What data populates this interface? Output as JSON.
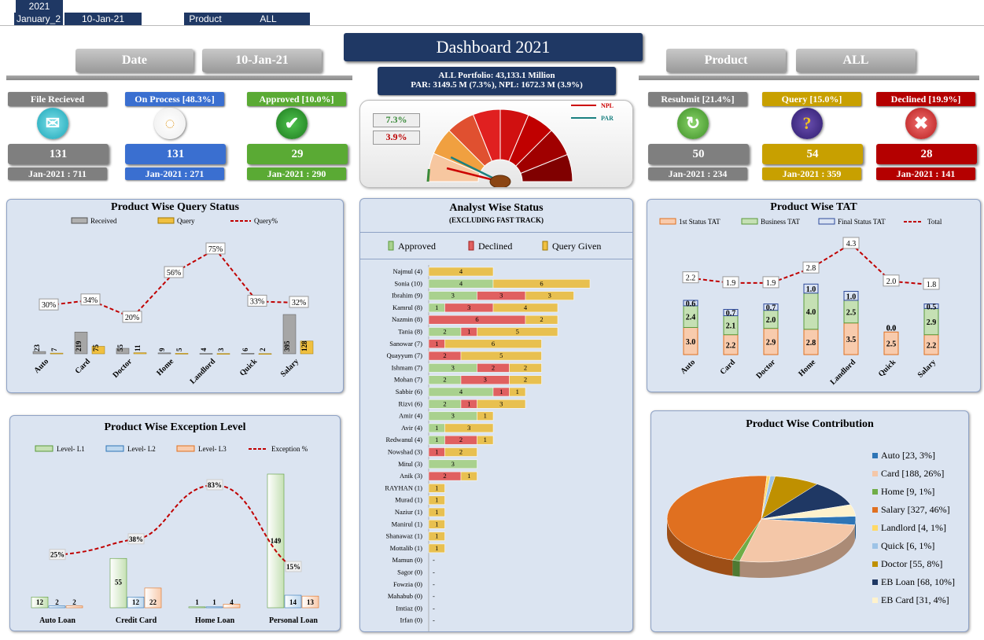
{
  "filters": {
    "year": "2021",
    "month": "January_2",
    "date": "10-Jan-21",
    "product_label": "Product",
    "product_value": "ALL"
  },
  "header": {
    "date_label": "Date",
    "date_value": "10-Jan-21",
    "title": "Dashboard 2021",
    "product_label": "Product",
    "product_value": "ALL",
    "portfolio_line1": "ALL Portfolio: 43,133.1  Million",
    "portfolio_line2": "PAR: 3149.5 M (7.3%), NPL: 1672.3 M (3.9%)"
  },
  "gauge": {
    "par": "7.3%",
    "npl": "3.9%",
    "legend_npl": "NPL",
    "legend_par": "PAR",
    "par_value": 7.3,
    "npl_value": 3.9
  },
  "kpis": [
    {
      "label": "File Recieved",
      "count": "131",
      "month": "Jan-2021 : 711",
      "color": "#7f7f7f",
      "icon": "envelope-icon"
    },
    {
      "label": "On Process [48.3%]",
      "count": "131",
      "month": "Jan-2021 : 271",
      "color": "#3a6fd0",
      "icon": "loading-icon"
    },
    {
      "label": "Approved [10.0%]",
      "count": "29",
      "month": "Jan-2021 : 290",
      "color": "#5aaa34",
      "icon": "check-icon"
    },
    {
      "label": "Resubmit [21.4%]",
      "count": "50",
      "month": "Jan-2021 : 234",
      "color": "#7f7f7f",
      "icon": "refresh-icon"
    },
    {
      "label": "Query [15.0%]",
      "count": "54",
      "month": "Jan-2021 : 359",
      "color": "#c8a000",
      "icon": "question-icon"
    },
    {
      "label": "Declined [19.9%]",
      "count": "28",
      "month": "Jan-2021 : 141",
      "color": "#b40000",
      "icon": "cross-icon"
    }
  ],
  "chart_data": [
    {
      "type": "bar",
      "title": "Product Wise Query Status",
      "categories": [
        "Auto",
        "Card",
        "Doctor",
        "Home",
        "Landlord",
        "Quick",
        "Salary"
      ],
      "series": [
        {
          "name": "Received",
          "values": [
            23,
            219,
            55,
            9,
            4,
            6,
            395
          ]
        },
        {
          "name": "Query",
          "values": [
            7,
            75,
            11,
            5,
            3,
            2,
            128
          ]
        },
        {
          "name": "Query%",
          "values": [
            30,
            34,
            20,
            56,
            75,
            33,
            32
          ],
          "labels": [
            "30%",
            "34%",
            "20%",
            "56%",
            "75%",
            "33%",
            "32%"
          ]
        }
      ]
    },
    {
      "type": "bar",
      "title": "Analyst Wise Status",
      "subtitle": "(EXCLUDING FAST TRACK)",
      "legend": [
        "Approved",
        "Declined",
        "Query Given"
      ],
      "analysts": [
        {
          "name": "Najmul (4)",
          "approved": "",
          "declined": "-",
          "query": "4",
          "a": 0,
          "d": 0,
          "q": 4
        },
        {
          "name": "Sonia (10)",
          "approved": "4",
          "declined": "-",
          "query": "6",
          "a": 4,
          "d": 0,
          "q": 6
        },
        {
          "name": "Ibrahim (9)",
          "approved": "3",
          "declined": "3",
          "query": "3",
          "a": 3,
          "d": 3,
          "q": 3
        },
        {
          "name": "Kamrul (8)",
          "approved": "1",
          "declined": "3",
          "query": "4",
          "a": 1,
          "d": 3,
          "q": 4
        },
        {
          "name": "Nazmin (8)",
          "approved": "",
          "declined": "6",
          "query": "2",
          "a": 0,
          "d": 6,
          "q": 2
        },
        {
          "name": "Tania (8)",
          "approved": "2",
          "declined": "1",
          "query": "5",
          "a": 2,
          "d": 1,
          "q": 5
        },
        {
          "name": "Sanowar (7)",
          "approved": "",
          "declined": "1",
          "query": "6",
          "a": 0,
          "d": 1,
          "q": 6
        },
        {
          "name": "Quayyum (7)",
          "approved": "",
          "declined": "2",
          "query": "5",
          "a": 0,
          "d": 2,
          "q": 5
        },
        {
          "name": "Ishmam (7)",
          "approved": "3",
          "declined": "2",
          "query": "2",
          "a": 3,
          "d": 2,
          "q": 2
        },
        {
          "name": "Mohan (7)",
          "approved": "2",
          "declined": "3",
          "query": "2",
          "a": 2,
          "d": 3,
          "q": 2
        },
        {
          "name": "Sabbir (6)",
          "approved": "4",
          "declined": "1",
          "query": "1",
          "a": 4,
          "d": 1,
          "q": 1
        },
        {
          "name": "Rizvi (6)",
          "approved": "2",
          "declined": "1",
          "query": "3",
          "a": 2,
          "d": 1,
          "q": 3
        },
        {
          "name": "Amir (4)",
          "approved": "3",
          "declined": "",
          "query": "1",
          "a": 3,
          "d": 0,
          "q": 1
        },
        {
          "name": "Avir (4)",
          "approved": "1",
          "declined": "",
          "query": "3",
          "a": 1,
          "d": 0,
          "q": 3
        },
        {
          "name": "Redwanul (4)",
          "approved": "1",
          "declined": "2",
          "query": "1",
          "a": 1,
          "d": 2,
          "q": 1
        },
        {
          "name": "Nowshad (3)",
          "approved": "",
          "declined": "1",
          "query": "2",
          "a": 0,
          "d": 1,
          "q": 2
        },
        {
          "name": "Mitul (3)",
          "approved": "3",
          "declined": "",
          "query": "",
          "a": 3,
          "d": 0,
          "q": 0
        },
        {
          "name": "Anik (3)",
          "approved": "",
          "declined": "2",
          "query": "1",
          "a": 0,
          "d": 2,
          "q": 1
        },
        {
          "name": "RAYHAN (1)",
          "approved": "",
          "declined": "",
          "query": "1",
          "a": 0,
          "d": 0,
          "q": 1
        },
        {
          "name": "Murad (1)",
          "approved": "",
          "declined": "",
          "query": "1",
          "a": 0,
          "d": 0,
          "q": 1
        },
        {
          "name": "Naziur (1)",
          "approved": "",
          "declined": "",
          "query": "1",
          "a": 0,
          "d": 0,
          "q": 1
        },
        {
          "name": "Manirul (1)",
          "approved": "",
          "declined": "",
          "query": "1",
          "a": 0,
          "d": 0,
          "q": 1
        },
        {
          "name": "Shanawaz (1)",
          "approved": "",
          "declined": "",
          "query": "1",
          "a": 0,
          "d": 0,
          "q": 1
        },
        {
          "name": "Mottalib (1)",
          "approved": "",
          "declined": "",
          "query": "1",
          "a": 0,
          "d": 0,
          "q": 1
        },
        {
          "name": "Mamun (0)",
          "approved": "",
          "declined": "",
          "query": "",
          "a": 0,
          "d": 0,
          "q": 0
        },
        {
          "name": "Sagor (0)",
          "approved": "",
          "declined": "",
          "query": "",
          "a": 0,
          "d": 0,
          "q": 0
        },
        {
          "name": "Fowzia (0)",
          "approved": "",
          "declined": "",
          "query": "",
          "a": 0,
          "d": 0,
          "q": 0
        },
        {
          "name": "Mahabub (0)",
          "approved": "",
          "declined": "",
          "query": "",
          "a": 0,
          "d": 0,
          "q": 0
        },
        {
          "name": "Imtiaz (0)",
          "approved": "",
          "declined": "",
          "query": "",
          "a": 0,
          "d": 0,
          "q": 0
        },
        {
          "name": "Irfan (0)",
          "approved": "",
          "declined": "",
          "query": "",
          "a": 0,
          "d": 0,
          "q": 0
        }
      ]
    },
    {
      "type": "bar",
      "title": "Product Wise TAT",
      "categories": [
        "Auto",
        "Card",
        "Doctor",
        "Home",
        "Landlord",
        "Quick",
        "Salary"
      ],
      "series": [
        {
          "name": "1st Status TAT",
          "values": [
            3.0,
            2.2,
            2.9,
            2.8,
            3.5,
            2.5,
            2.2
          ]
        },
        {
          "name": "Business TAT",
          "values": [
            2.4,
            2.1,
            2.0,
            4.0,
            2.5,
            0.0,
            2.9
          ]
        },
        {
          "name": "Final Status TAT",
          "values": [
            0.6,
            0.7,
            0.7,
            1.0,
            1.0,
            0.0,
            0.5
          ]
        },
        {
          "name": "Total",
          "values": [
            2.2,
            1.9,
            1.9,
            2.8,
            4.3,
            2.0,
            1.8
          ]
        }
      ]
    },
    {
      "type": "bar",
      "title": "Product Wise Exception Level",
      "categories": [
        "Auto Loan",
        "Credit Card",
        "Home Loan",
        "Personal Loan"
      ],
      "series": [
        {
          "name": "Level- L1",
          "values": [
            12,
            55,
            1,
            149
          ]
        },
        {
          "name": "Level- L2",
          "values": [
            2,
            12,
            1,
            14
          ]
        },
        {
          "name": "Level- L3",
          "values": [
            2,
            22,
            4,
            13
          ]
        },
        {
          "name": "Exception %",
          "values": [
            25,
            38,
            83,
            15
          ],
          "labels": [
            "25%",
            "38%",
            "83%",
            "15%"
          ]
        }
      ]
    },
    {
      "type": "pie",
      "title": "Product Wise Contribution",
      "slices": [
        {
          "label": "Auto [23, 3%]",
          "value": 23,
          "color": "#2e75b6"
        },
        {
          "label": "Card [188, 26%]",
          "value": 188,
          "color": "#f4c7a8"
        },
        {
          "label": "Home [9, 1%]",
          "value": 9,
          "color": "#70ad47"
        },
        {
          "label": "Salary [327, 46%]",
          "value": 327,
          "color": "#e07020"
        },
        {
          "label": "Landlord [4, 1%]",
          "value": 4,
          "color": "#ffd966"
        },
        {
          "label": "Quick [6, 1%]",
          "value": 6,
          "color": "#9dc3e6"
        },
        {
          "label": "Doctor [55, 8%]",
          "value": 55,
          "color": "#bf9000"
        },
        {
          "label": "EB Loan [68, 10%]",
          "value": 68,
          "color": "#1f3864"
        },
        {
          "label": "EB Card [31, 4%]",
          "value": 31,
          "color": "#fff2cc"
        }
      ]
    }
  ]
}
